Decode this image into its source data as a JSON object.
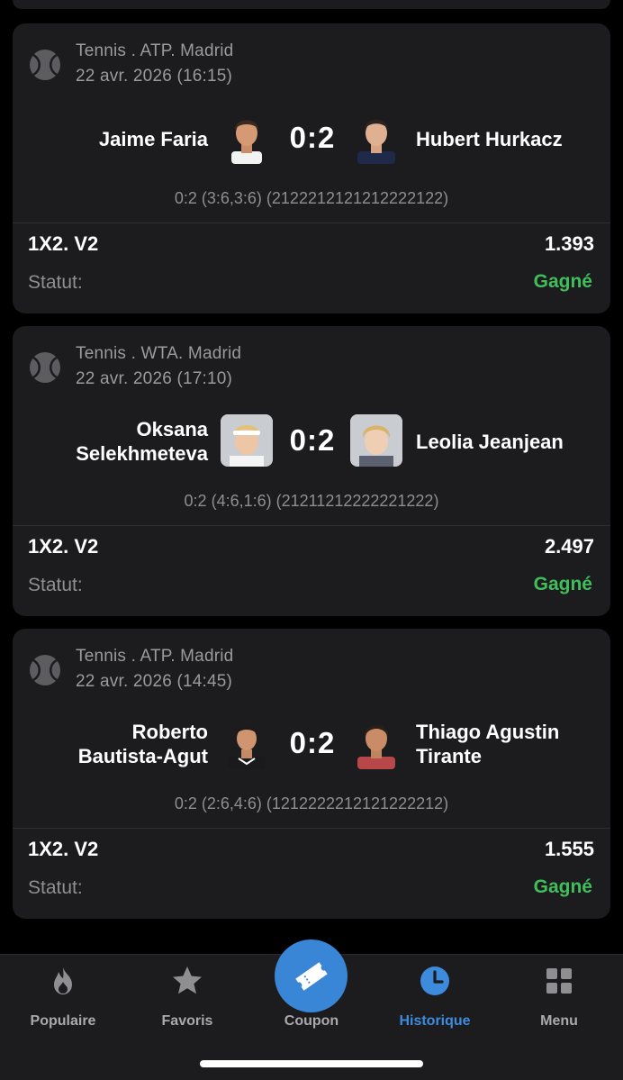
{
  "matches": [
    {
      "league": "Tennis . ATP. Madrid",
      "date": "22 avr. 2026 (16:15)",
      "home": "Jaime Faria",
      "away": "Hubert Hurkacz",
      "score": "0:2",
      "detail": "0:2 (3:6,3:6) (2122212121212222122)",
      "bet": "1X2. V2",
      "odds": "1.393",
      "status_label": "Statut:",
      "status": "Gagné"
    },
    {
      "league": "Tennis . WTA. Madrid",
      "date": "22 avr. 2026 (17:10)",
      "home_line1": "Oksana",
      "home_line2": "Selekhmeteva",
      "away": "Leolia Jeanjean",
      "score": "0:2",
      "detail": "0:2 (4:6,1:6) (21211212222221222)",
      "bet": "1X2. V2",
      "odds": "2.497",
      "status_label": "Statut:",
      "status": "Gagné"
    },
    {
      "league": "Tennis . ATP. Madrid",
      "date": "22 avr. 2026 (14:45)",
      "home_line1": "Roberto",
      "home_line2": "Bautista-Agut",
      "away_line1": "Thiago Agustin",
      "away_line2": "Tirante",
      "score": "0:2",
      "detail": "0:2 (2:6,4:6) (1212222212121222212)",
      "bet": "1X2. V2",
      "odds": "1.555",
      "status_label": "Statut:",
      "status": "Gagné"
    }
  ],
  "nav": {
    "items": [
      {
        "label": "Populaire",
        "icon": "flame-icon"
      },
      {
        "label": "Favoris",
        "icon": "star-icon"
      },
      {
        "label": "Coupon",
        "icon": "ticket-icon"
      },
      {
        "label": "Historique",
        "icon": "clock-icon",
        "active": true
      },
      {
        "label": "Menu",
        "icon": "grid-icon"
      }
    ]
  },
  "colors": {
    "background": "#000000",
    "card": "#1c1c1e",
    "win_status": "#3fbe5c",
    "accent": "#3a86d6"
  }
}
